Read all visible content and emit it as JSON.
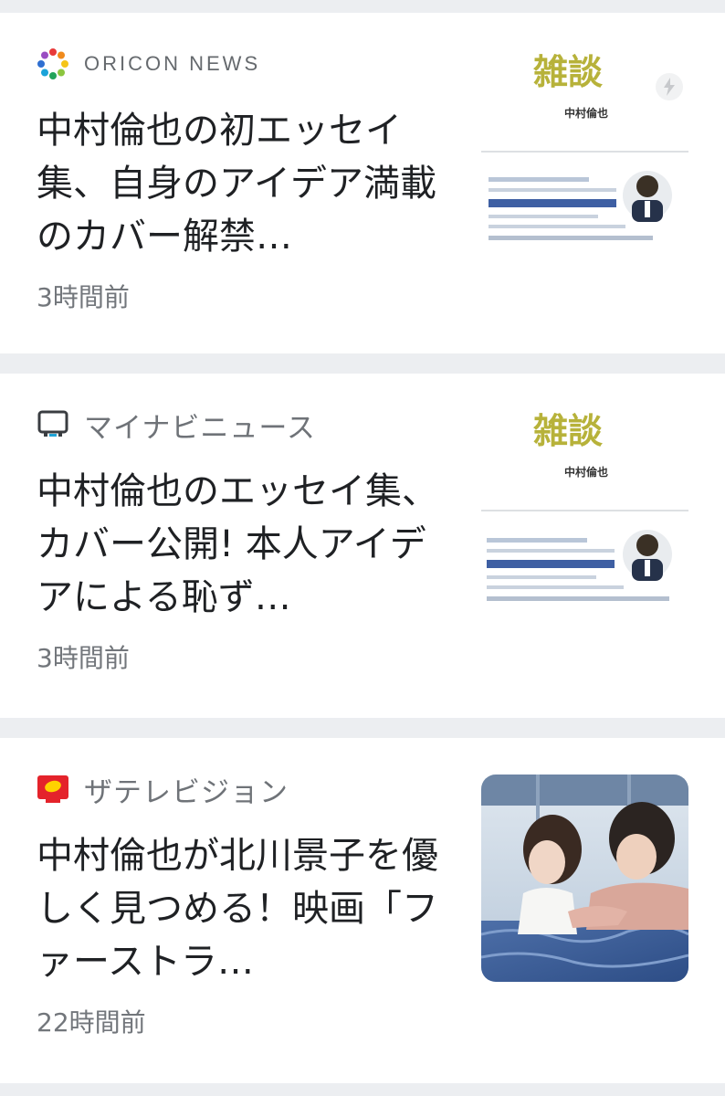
{
  "articles": [
    {
      "source": "ORICON NEWS",
      "headline": "中村倫也の初エッセイ集、自身のアイデア満載のカバー解禁…",
      "time": "3時間前",
      "thumbnail_icon": "book-cover-image"
    },
    {
      "source": "マイナビニュース",
      "headline": "中村倫也のエッセイ集、カバー公開! 本人アイデアによる恥ず…",
      "time": "3時間前",
      "thumbnail_icon": "book-cover-image"
    },
    {
      "source": "ザテレビジョン",
      "headline": "中村倫也が北川景子を優しく見つめる！映画「ファーストラ…",
      "time": "22時間前",
      "thumbnail_icon": "movie-still-image"
    }
  ],
  "thumbnail_text": {
    "title": "雑談",
    "author": "中村倫也"
  },
  "colors": {
    "background": "#eceef1",
    "card": "#ffffff",
    "headline": "#1f2124",
    "meta": "#72767b",
    "thetv_red": "#e4232b",
    "thetv_yellow": "#ffd200"
  }
}
